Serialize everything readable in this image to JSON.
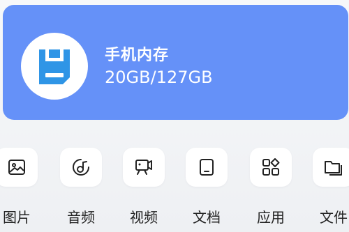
{
  "storage": {
    "title": "手机内存",
    "usage": "20GB/127GB",
    "icon": "sd-card-icon",
    "accent_color": "#6591f8",
    "icon_color": "#2f95e6"
  },
  "categories": [
    {
      "label": "图片",
      "icon": "image-icon"
    },
    {
      "label": "音频",
      "icon": "music-icon"
    },
    {
      "label": "视频",
      "icon": "video-icon"
    },
    {
      "label": "文档",
      "icon": "document-icon"
    },
    {
      "label": "应用",
      "icon": "apps-icon"
    },
    {
      "label": "文件",
      "icon": "folder-icon"
    }
  ]
}
